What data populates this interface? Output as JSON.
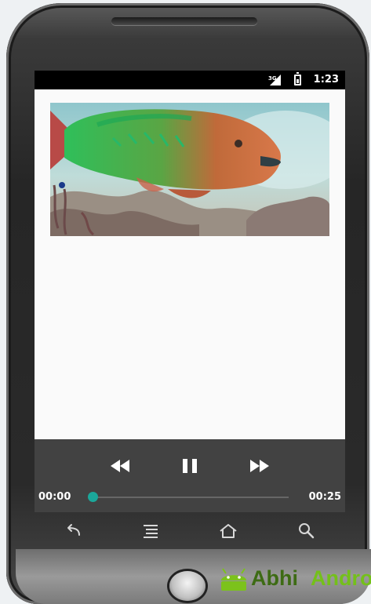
{
  "status_bar": {
    "network_label": "3G",
    "time": "1:23"
  },
  "video": {
    "content": "underwater parrotfish over coral reef"
  },
  "media_controller": {
    "current_time": "00:00",
    "total_time": "00:25",
    "progress": 0.0,
    "buttons": [
      "rewind-icon",
      "pause-icon",
      "fast-forward-icon"
    ]
  },
  "nav_bar": {
    "buttons": [
      "back-icon",
      "menu-icon",
      "home-icon",
      "search-icon"
    ]
  },
  "watermark": {
    "part1": "Abhi",
    "part2": "Android"
  },
  "colors": {
    "accent": "#1ba79a",
    "controller_bg": "#424242",
    "status_bar_bg": "#000000",
    "screen_bg": "#fafafa"
  }
}
